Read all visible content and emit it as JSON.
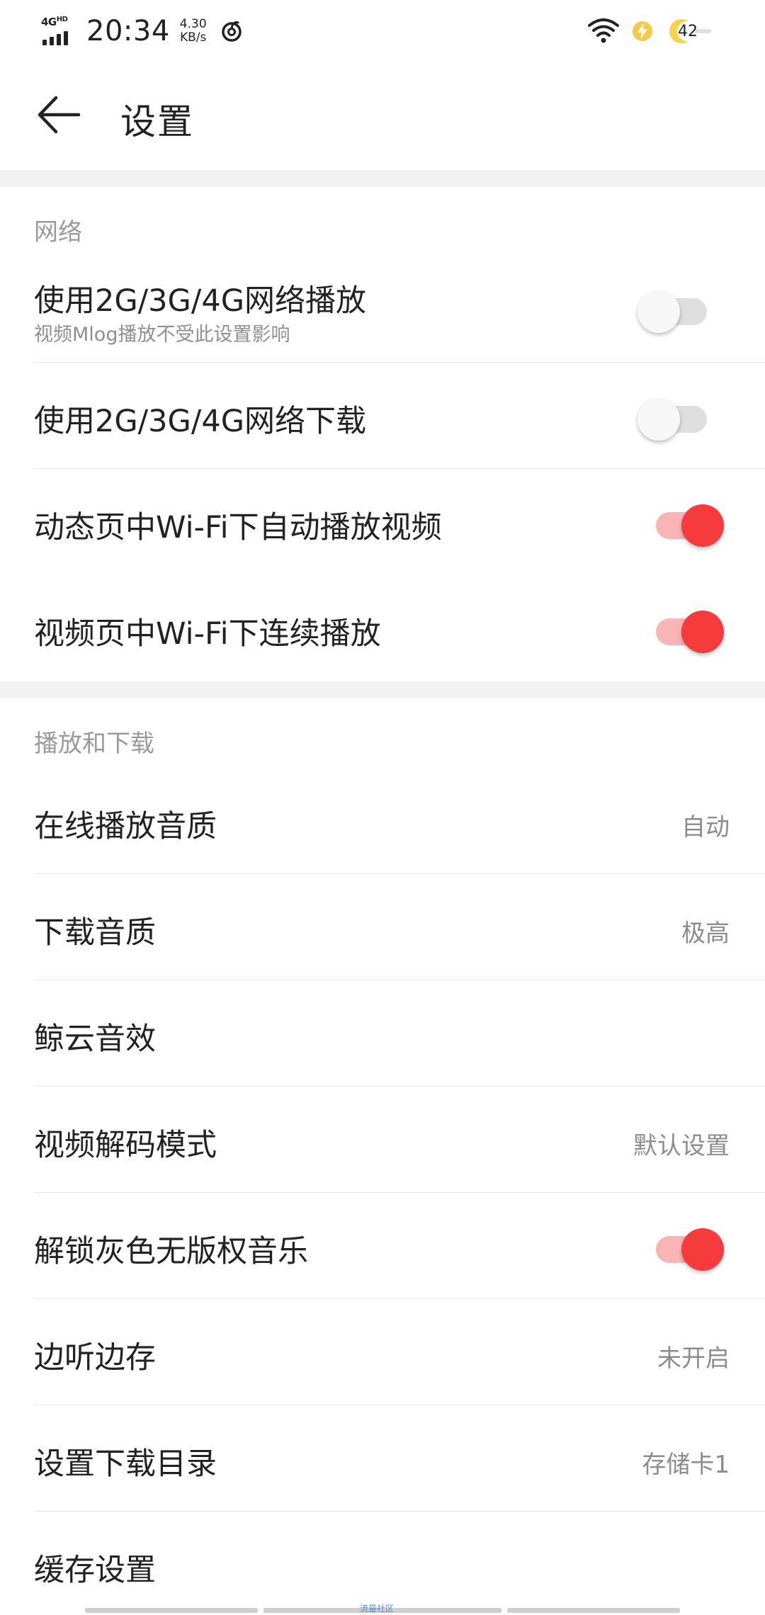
{
  "status_bar": {
    "network": "4G",
    "network_sup": "HD",
    "time": "20:34",
    "speed_value": "4.30",
    "speed_unit": "KB/s",
    "battery_text": "42",
    "icons": [
      "signal-icon",
      "netease-music-icon",
      "wifi-icon",
      "charging-icon",
      "battery-icon"
    ]
  },
  "header": {
    "back_icon": "arrow-left-icon",
    "title": "设置"
  },
  "sections": {
    "network": {
      "title": "网络",
      "rows": [
        {
          "label": "使用2G/3G/4G网络播放",
          "sub": "视频Mlog播放不受此设置影响",
          "toggle": false
        },
        {
          "label": "使用2G/3G/4G网络下载",
          "toggle": false
        },
        {
          "label": "动态页中Wi-Fi下自动播放视频",
          "toggle": true
        },
        {
          "label": "视频页中Wi-Fi下连续播放",
          "toggle": true
        }
      ]
    },
    "playback": {
      "title": "播放和下载",
      "rows": [
        {
          "label": "在线播放音质",
          "value": "自动"
        },
        {
          "label": "下载音质",
          "value": "极高"
        },
        {
          "label": "鲸云音效",
          "value": ""
        },
        {
          "label": "视频解码模式",
          "value": "默认设置"
        },
        {
          "label": "解锁灰色无版权音乐",
          "toggle": true
        },
        {
          "label": "边听边存",
          "value": "未开启"
        },
        {
          "label": "设置下载目录",
          "value": "存储卡1"
        },
        {
          "label": "缓存设置",
          "value": ""
        }
      ]
    }
  },
  "colors": {
    "accent": "#f53b3b",
    "accent_track": "#f9b5b5",
    "off_track": "#dedede",
    "section_band": "#f2f2f2",
    "text_primary": "#222222",
    "text_secondary": "#8c8c8c"
  },
  "watermark": "流量社区"
}
